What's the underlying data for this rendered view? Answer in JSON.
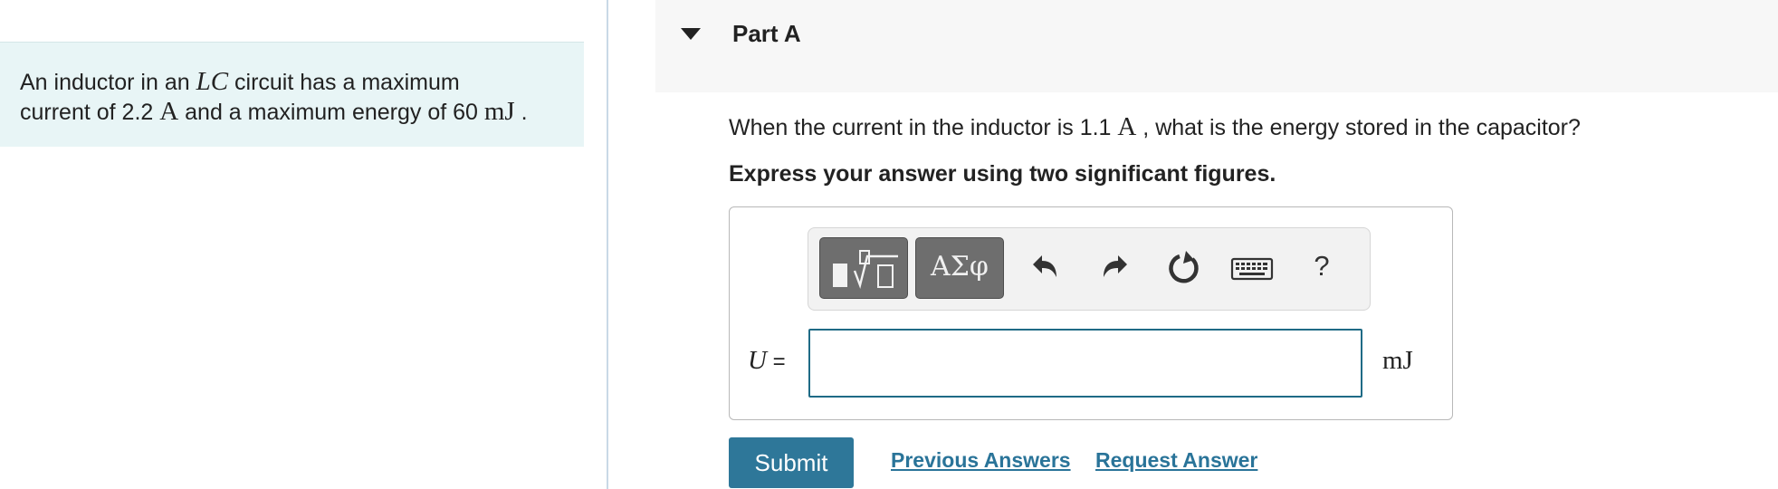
{
  "problem": {
    "text_1": "An inductor in an ",
    "circuit_symbol": "LC",
    "text_2": " circuit has a maximum",
    "text_3": "current of 2.2 ",
    "current_unit": "A",
    "text_4": " and a maximum energy of 60 ",
    "energy_unit": "mJ",
    "text_5": " ."
  },
  "part": {
    "title": "Part A",
    "collapse_icon": "caret-down-icon"
  },
  "question": {
    "text_1": "When the current in the inductor is 1.1 ",
    "current_unit": "A",
    "text_2": " , what is the energy stored in the capacitor?"
  },
  "instruction": "Express your answer using two significant figures.",
  "toolbar": {
    "templates_icon": "templates-icon",
    "symbols_label": "ΑΣφ",
    "undo_icon": "undo-icon",
    "redo_icon": "redo-icon",
    "reset_icon": "reset-icon",
    "keyboard_icon": "keyboard-icon",
    "help_label": "?"
  },
  "answer": {
    "variable": "U",
    "equals": " =",
    "value": "",
    "unit": "mJ"
  },
  "actions": {
    "submit_label": "Submit",
    "previous_answers_label": "Previous Answers",
    "request_answer_label": "Request Answer"
  },
  "colors": {
    "problem_bg": "#e8f5f6",
    "submit_bg": "#2e7799",
    "link": "#2a7499",
    "input_border": "#1f6b86"
  }
}
